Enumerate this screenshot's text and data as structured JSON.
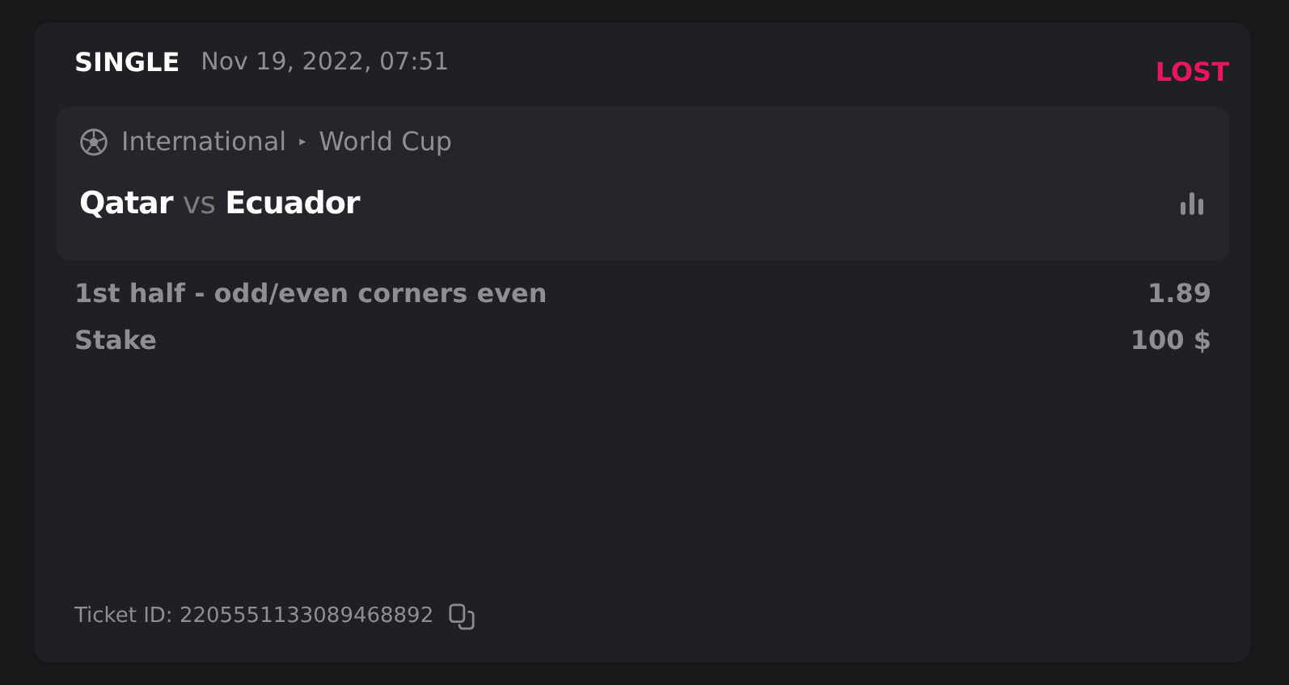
{
  "bet": {
    "type": "SINGLE",
    "date": "Nov 19, 2022, 07:51",
    "status": {
      "label": "LOST",
      "kind": "lost"
    }
  },
  "event": {
    "category": "International",
    "separator": "▸",
    "league": "World Cup",
    "home": "Qatar",
    "vs": "vs",
    "away": "Ecuador"
  },
  "rows": [
    {
      "label": "1st half - odd/even corners even",
      "value": "1.89"
    },
    {
      "label": "Stake",
      "value": "100 $"
    }
  ],
  "ticket": {
    "label": "Ticket ID: 2205551133089468892"
  }
}
